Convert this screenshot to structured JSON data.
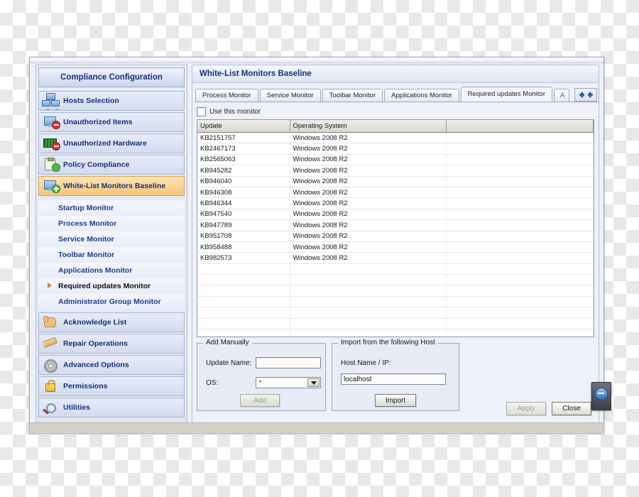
{
  "sidebar": {
    "title": "Compliance Configuration",
    "items": [
      {
        "label": "Hosts Selection",
        "icon": "hosts-network-icon",
        "selected": false
      },
      {
        "label": "Unauthorized Items",
        "icon": "computer-deny-icon",
        "selected": false
      },
      {
        "label": "Unauthorized Hardware",
        "icon": "hardware-deny-icon",
        "selected": false
      },
      {
        "label": "Policy Compliance",
        "icon": "clipboard-check-icon",
        "selected": false
      },
      {
        "label": "White-List Monitors Baseline",
        "icon": "monitor-add-icon",
        "selected": true
      }
    ],
    "sub_items": [
      {
        "label": "Startup Monitor",
        "active": false
      },
      {
        "label": "Process Monitor",
        "active": false
      },
      {
        "label": "Service Monitor",
        "active": false
      },
      {
        "label": "Toolbar Monitor",
        "active": false
      },
      {
        "label": "Applications Monitor",
        "active": false
      },
      {
        "label": "Required updates Monitor",
        "active": true
      },
      {
        "label": "Administrator Group Monitor",
        "active": false
      }
    ],
    "items_bottom": [
      {
        "label": "Acknowledge List",
        "icon": "hand-icon"
      },
      {
        "label": "Repair Operations",
        "icon": "pencil-icon"
      },
      {
        "label": "Advanced Options",
        "icon": "gear-icon"
      },
      {
        "label": "Permissions",
        "icon": "lock-icon"
      },
      {
        "label": "Utilities",
        "icon": "magnifier-icon"
      }
    ]
  },
  "main": {
    "title": "White-List Monitors Baseline",
    "tabs": [
      {
        "label": "Process Monitor",
        "active": false
      },
      {
        "label": "Service Monitor",
        "active": false
      },
      {
        "label": "Toolbar Monitor",
        "active": false
      },
      {
        "label": "Applications Monitor",
        "active": false
      },
      {
        "label": "Required updates Monitor",
        "active": true
      },
      {
        "label": "A",
        "active": false
      }
    ],
    "tab_nav": {
      "prev": "scroll-tabs-left",
      "next": "scroll-tabs-right"
    },
    "use_monitor": {
      "label": "Use this monitor",
      "checked": false
    }
  },
  "table": {
    "columns": [
      "Update",
      "Operating System",
      ""
    ],
    "rows": [
      [
        "KB2151757",
        "Windows 2008 R2",
        ""
      ],
      [
        "KB2467173",
        "Windows 2008 R2",
        ""
      ],
      [
        "KB2565063",
        "Windows 2008 R2",
        ""
      ],
      [
        "KB945282",
        "Windows 2008 R2",
        ""
      ],
      [
        "KB946040",
        "Windows 2008 R2",
        ""
      ],
      [
        "KB946308",
        "Windows 2008 R2",
        ""
      ],
      [
        "KB946344",
        "Windows 2008 R2",
        ""
      ],
      [
        "KB947540",
        "Windows 2008 R2",
        ""
      ],
      [
        "KB947789",
        "Windows 2008 R2",
        ""
      ],
      [
        "KB951708",
        "Windows 2008 R2",
        ""
      ],
      [
        "KB958488",
        "Windows 2008 R2",
        ""
      ],
      [
        "KB982573",
        "Windows 2008 R2",
        ""
      ]
    ],
    "empty_rows": 11
  },
  "add_manually": {
    "legend": "Add Manually",
    "update_name_label": "Update Name:",
    "update_name_value": "",
    "update_name_placeholder": "",
    "os_label": "OS:",
    "os_value": "*",
    "add_button": "Add",
    "add_button_disabled": true
  },
  "import_host": {
    "legend": "Import from the following Host",
    "host_label": "Host Name / IP:",
    "host_value": "localhost",
    "import_button": "Import"
  },
  "footer": {
    "apply": "Apply",
    "apply_disabled": true,
    "close": "Close"
  },
  "colors": {
    "accent_blue": "#12307e",
    "selected_orange": "#f5c57a",
    "panel_bg": "#eef1f9",
    "statusbar": "#d4d2c6"
  }
}
